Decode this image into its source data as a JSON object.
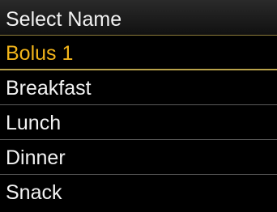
{
  "header": {
    "title": "Select Name"
  },
  "list": {
    "items": [
      {
        "label": "Bolus 1",
        "selected": true
      },
      {
        "label": "Breakfast",
        "selected": false
      },
      {
        "label": "Lunch",
        "selected": false
      },
      {
        "label": "Dinner",
        "selected": false
      },
      {
        "label": "Snack",
        "selected": false
      }
    ]
  },
  "colors": {
    "background": "#000000",
    "text": "#f2f2f2",
    "selected_text": "#f2b41a",
    "divider": "#5a5a5a",
    "selected_divider": "#b8a24a"
  }
}
